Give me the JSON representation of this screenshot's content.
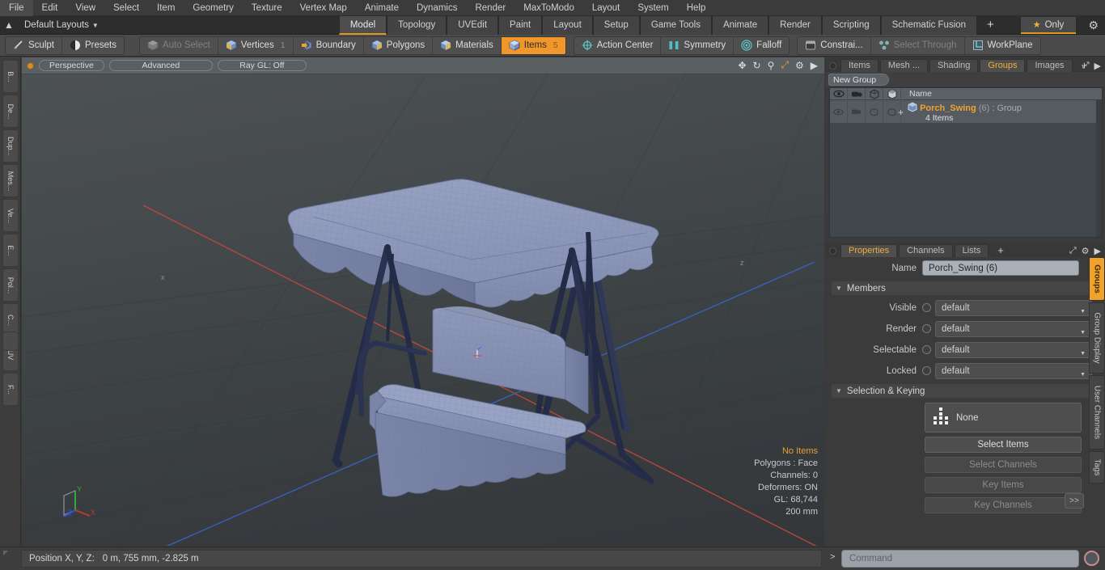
{
  "app": {
    "title": "Modo"
  },
  "menubar": {
    "items": [
      "File",
      "Edit",
      "View",
      "Select",
      "Item",
      "Geometry",
      "Texture",
      "Vertex Map",
      "Animate",
      "Dynamics",
      "Render",
      "MaxToModo",
      "Layout",
      "System",
      "Help"
    ]
  },
  "layoutbar": {
    "home_icon": "home-icon",
    "layout_name": "Default Layouts",
    "tabs": [
      {
        "label": "Model",
        "active": true
      },
      {
        "label": "Topology",
        "active": false
      },
      {
        "label": "UVEdit",
        "active": false
      },
      {
        "label": "Paint",
        "active": false
      },
      {
        "label": "Layout",
        "active": false
      },
      {
        "label": "Setup",
        "active": false
      },
      {
        "label": "Game Tools",
        "active": false
      },
      {
        "label": "Animate",
        "active": false
      },
      {
        "label": "Render",
        "active": false
      },
      {
        "label": "Scripting",
        "active": false
      },
      {
        "label": "Schematic Fusion",
        "active": false
      }
    ],
    "add_tab_label": "+",
    "only_label": "Only",
    "gear_icon": "gear-icon"
  },
  "toolbar": {
    "group1": [
      {
        "label": "Sculpt",
        "icon": "sculpt-icon",
        "state": "normal"
      },
      {
        "label": "Presets",
        "icon": "presets-icon",
        "state": "normal"
      }
    ],
    "group2": [
      {
        "label": "Auto Select",
        "icon": "cube-gray-icon",
        "state": "dim"
      },
      {
        "label": "Vertices",
        "icon": "vertices-icon",
        "state": "normal",
        "count": "1"
      },
      {
        "label": "Boundary",
        "icon": "boundary-icon",
        "state": "normal"
      },
      {
        "label": "Polygons",
        "icon": "polygons-icon",
        "state": "normal"
      },
      {
        "label": "Materials",
        "icon": "materials-icon",
        "state": "normal"
      },
      {
        "label": "Items",
        "icon": "items-icon",
        "state": "selected",
        "count": "5"
      }
    ],
    "group3": [
      {
        "label": "Action Center",
        "icon": "action-center-icon",
        "state": "normal"
      },
      {
        "label": "Symmetry",
        "icon": "symmetry-icon",
        "state": "normal"
      },
      {
        "label": "Falloff",
        "icon": "falloff-icon",
        "state": "normal"
      }
    ],
    "group4": [
      {
        "label": "Constrai...",
        "icon": "constraint-icon",
        "state": "normal"
      },
      {
        "label": "Select Through",
        "icon": "select-through-icon",
        "state": "dim"
      },
      {
        "label": "WorkPlane",
        "icon": "workplane-icon",
        "state": "normal"
      }
    ]
  },
  "left_strip": {
    "tabs": [
      "B...",
      "De...",
      "Dup...",
      "Mes...",
      "Ve...",
      "E...",
      "Pol...",
      "C...",
      "UV",
      "F..."
    ]
  },
  "viewport": {
    "header": {
      "dot_icon": "viewport-dot-icon",
      "pills": [
        "Perspective",
        "Advanced",
        "Ray GL: Off"
      ],
      "icons": [
        "move-icon",
        "rotate-icon",
        "zoom-icon",
        "maximize-icon",
        "gear-icon",
        "chevron-right-icon"
      ]
    },
    "stats": {
      "selection": "No Items",
      "polygons": "Polygons : Face",
      "channels": "Channels: 0",
      "deformers": "Deformers: ON",
      "gl": "GL: 68,744",
      "scale": "200 mm"
    },
    "axes": {
      "x": "X",
      "y": "Y",
      "z": "Z"
    },
    "model_name": "porch-swing-model"
  },
  "right_panel": {
    "top_tabs": [
      {
        "label": "Items",
        "active": false
      },
      {
        "label": "Mesh ...",
        "active": false
      },
      {
        "label": "Shading",
        "active": false
      },
      {
        "label": "Groups",
        "active": true
      },
      {
        "label": "Images",
        "active": false
      }
    ],
    "top_tabs_add": "+",
    "new_group_label": "New Group",
    "list": {
      "columns": [
        "eye-icon",
        "render-icon",
        "wire-cube-icon",
        "shaded-cube-icon"
      ],
      "name_header": "Name",
      "rows": [
        {
          "expand": "+",
          "icon": "group-cube-icon",
          "name": "Porch_Swing",
          "count": "(6)",
          "type": ": Group",
          "subtitle": "4 Items"
        }
      ]
    },
    "props_tabs": [
      {
        "label": "Properties",
        "active": true
      },
      {
        "label": "Channels",
        "active": false
      },
      {
        "label": "Lists",
        "active": false
      }
    ],
    "props_tabs_add": "+",
    "props_icons": [
      "maximize-icon",
      "gear-icon",
      "chevron-right-icon"
    ],
    "name_label": "Name",
    "name_value": "Porch_Swing (6)",
    "members_section": "Members",
    "members": [
      {
        "label": "Visible",
        "value": "default"
      },
      {
        "label": "Render",
        "value": "default"
      },
      {
        "label": "Selectable",
        "value": "default"
      },
      {
        "label": "Locked",
        "value": "default"
      }
    ],
    "selection_section": "Selection & Keying",
    "selection_none": "None",
    "selection_buttons": [
      {
        "label": "Select Items",
        "enabled": true
      },
      {
        "label": "Select Channels",
        "enabled": false
      },
      {
        "label": "Key Items",
        "enabled": false
      },
      {
        "label": "Key Channels",
        "enabled": false
      }
    ],
    "more_label": ">>",
    "side_tabs": [
      {
        "label": "Groups",
        "active": true
      },
      {
        "label": "Group Display",
        "active": false
      },
      {
        "label": "User Channels",
        "active": false
      },
      {
        "label": "Tags",
        "active": false
      }
    ]
  },
  "bottom": {
    "position_label": "Position X, Y, Z:",
    "position_value": "0 m, 755 mm, -2.825 m",
    "command_prompt": ">",
    "command_placeholder": "Command",
    "command_record_icon": "record-icon"
  },
  "colors": {
    "accent_orange": "#f0a22b",
    "selected_orange": "#f0962a",
    "panel_bg": "#3b3b3b",
    "axis_x": "#c4483c",
    "axis_z": "#3a63c8",
    "model_fabric": "#8a93b5",
    "model_frame": "#2b3352"
  }
}
